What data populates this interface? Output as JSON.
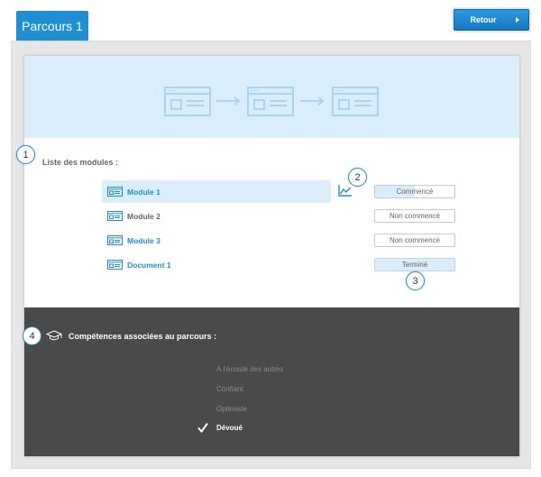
{
  "tab": {
    "label": "Parcours 1"
  },
  "header": {
    "back_label": "Retour"
  },
  "modules": {
    "title": "Liste des modules :",
    "items": [
      {
        "label": "Module 1",
        "status": "Commencé",
        "progress": 0.5,
        "selected": true
      },
      {
        "label": "Module 2",
        "status": "Non commencé",
        "progress": 0
      },
      {
        "label": "Module 3",
        "status": "Non commencé",
        "progress": 0
      },
      {
        "label": "Document 1",
        "status": "Terminé",
        "progress": 1
      }
    ]
  },
  "callouts": [
    "1",
    "2",
    "3",
    "4"
  ],
  "skills": {
    "title": "Compétences associées au parcours :",
    "items": [
      {
        "label": "À l'écoute des autres",
        "acquired": false
      },
      {
        "label": "Confiant",
        "acquired": false
      },
      {
        "label": "Optimiste",
        "acquired": false
      },
      {
        "label": "Dévoué",
        "acquired": true
      }
    ]
  },
  "colors": {
    "accent": "#1e8fd2",
    "banner": "#d9edfa",
    "skills_bg": "#4a4a4a"
  },
  "icons": [
    "arrow-right-icon",
    "module-window-icon",
    "stats-chart-icon",
    "graduation-cap-icon",
    "checkmark-icon"
  ]
}
